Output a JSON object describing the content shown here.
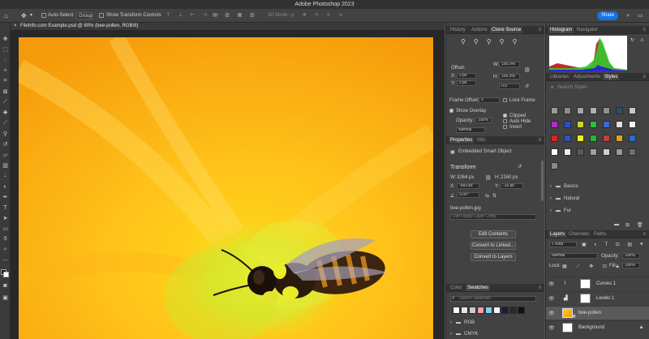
{
  "app": {
    "title": "Adobe Photoshop 2023"
  },
  "options": {
    "auto_select_label": "Auto-Select:",
    "auto_select_value": "Group",
    "transform_controls_label": "Show Transform Controls",
    "mode_label": "3D Mode:",
    "share_label": "Share"
  },
  "document": {
    "tab_title": "FileInfo.com Example.psd @ 80% (bee-pollen, RGB/8)"
  },
  "clone_panel": {
    "tabs": [
      "History",
      "Actions",
      "Clone Source"
    ],
    "offset_label": "Offset:",
    "x_label": "X:",
    "x_value": "0 px",
    "y_label": "Y:",
    "y_value": "0 px",
    "w_label": "W:",
    "w_value": "100.0%",
    "h_label": "H:",
    "h_value": "100.0%",
    "angle_value": "0.0",
    "frame_offset_label": "Frame Offset:",
    "frame_offset_value": "0",
    "lock_frame_label": "Lock Frame",
    "show_overlay_label": "Show Overlay",
    "opacity_label": "Opacity:",
    "opacity_value": "100%",
    "blend_value": "Normal",
    "clipped_label": "Clipped",
    "auto_hide_label": "Auto Hide",
    "invert_label": "Invert"
  },
  "properties": {
    "tabs": [
      "Properties",
      "Info"
    ],
    "object_type": "Embedded Smart Object",
    "transform_label": "Transform",
    "w_label": "W:",
    "w_value": "3264 px",
    "h_label": "H:",
    "h_value": "2160 px",
    "x_label": "X:",
    "x_value": "-683 px",
    "y_label": "Y:",
    "y_value": "-16 px",
    "angle_value": "0.00°",
    "file_name": "bee-pollen.jpg",
    "layer_comp": "Don't Apply Layer Comp",
    "edit_contents": "Edit Contents",
    "convert_linked": "Convert to Linked...",
    "convert_layers": "Convert to Layers"
  },
  "swatches": {
    "tabs": [
      "Color",
      "Swatches"
    ],
    "search_placeholder": "Search Swatches",
    "groups": [
      "RGB",
      "CMYK"
    ],
    "colors": [
      "#ffffff",
      "#e6e6e6",
      "#cccccc",
      "#ff9aa6",
      "#7ad3f0",
      "#f5f5f5",
      "#1c1c3a",
      "#2a2a2a",
      "#111111"
    ]
  },
  "histogram": {
    "tabs": [
      "Histogram",
      "Navigator"
    ]
  },
  "styles": {
    "tabs": [
      "Libraries",
      "Adjustments",
      "Styles"
    ],
    "search_placeholder": "Search Styles",
    "rows": [
      [
        "#9a9a9a",
        "#8d8d8d",
        "#a4a4a4",
        "#b0b0b0",
        "#909090",
        "#2e4f66",
        "#c8c8c8"
      ],
      [
        "#b22ad0",
        "#2b4fcc",
        "#c8d82a",
        "#28c040",
        "#3a6ad8",
        "#e0e0e0",
        "#f4f4f4"
      ],
      [
        "#e02020",
        "#3050d0",
        "#f0f020",
        "#28b040",
        "#c04040",
        "#e0a020",
        "#2a6ad0"
      ],
      [
        "#ffffff",
        "#ececec",
        "#5a5a5a",
        "#a0a0a0",
        "#d0d0d0",
        "#9a9a9a",
        "#707070"
      ]
    ],
    "groups": [
      "Basics",
      "Natural",
      "Fur"
    ]
  },
  "layers": {
    "tabs": [
      "Layers",
      "Channels",
      "Paths"
    ],
    "kind_label": "Kind",
    "blend_value": "Normal",
    "opacity_label": "Opacity:",
    "opacity_value": "100%",
    "lock_label": "Lock:",
    "fill_label": "Fill:",
    "fill_value": "100%",
    "items": [
      {
        "name": "Curves 1"
      },
      {
        "name": "Levels 1"
      },
      {
        "name": "bee-pollen"
      },
      {
        "name": "Background"
      }
    ]
  }
}
